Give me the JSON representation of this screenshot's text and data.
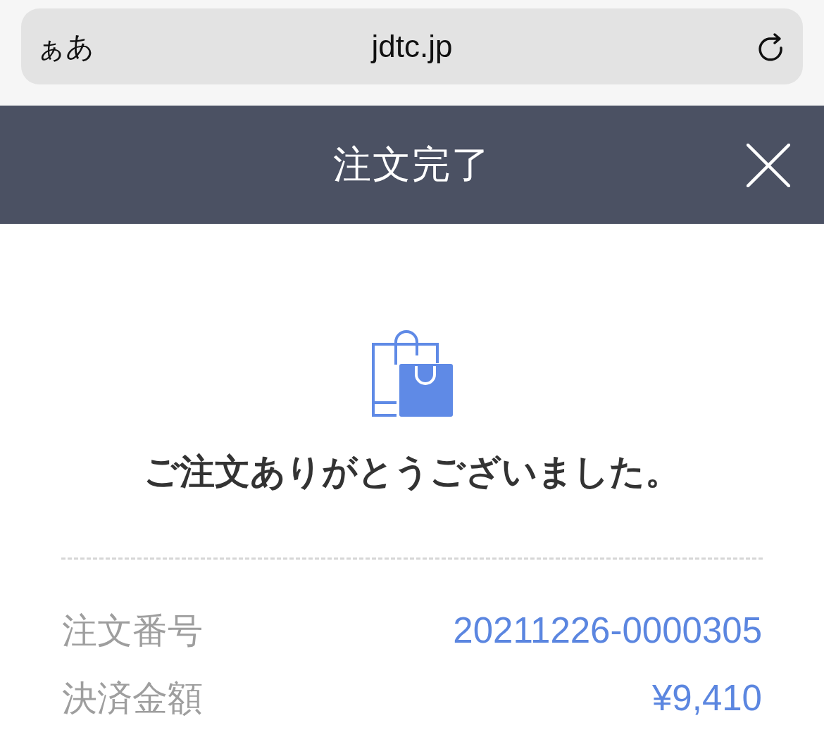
{
  "browser_bar": {
    "text_size_button": "ぁあ",
    "address": "jdtc.jp"
  },
  "header": {
    "title": "注文完了"
  },
  "confirmation": {
    "message": "ご注文ありがとうございました。"
  },
  "details": [
    {
      "label": "注文番号",
      "value": "20211226-0000305"
    },
    {
      "label": "決済金額",
      "value": "¥9,410"
    }
  ]
}
